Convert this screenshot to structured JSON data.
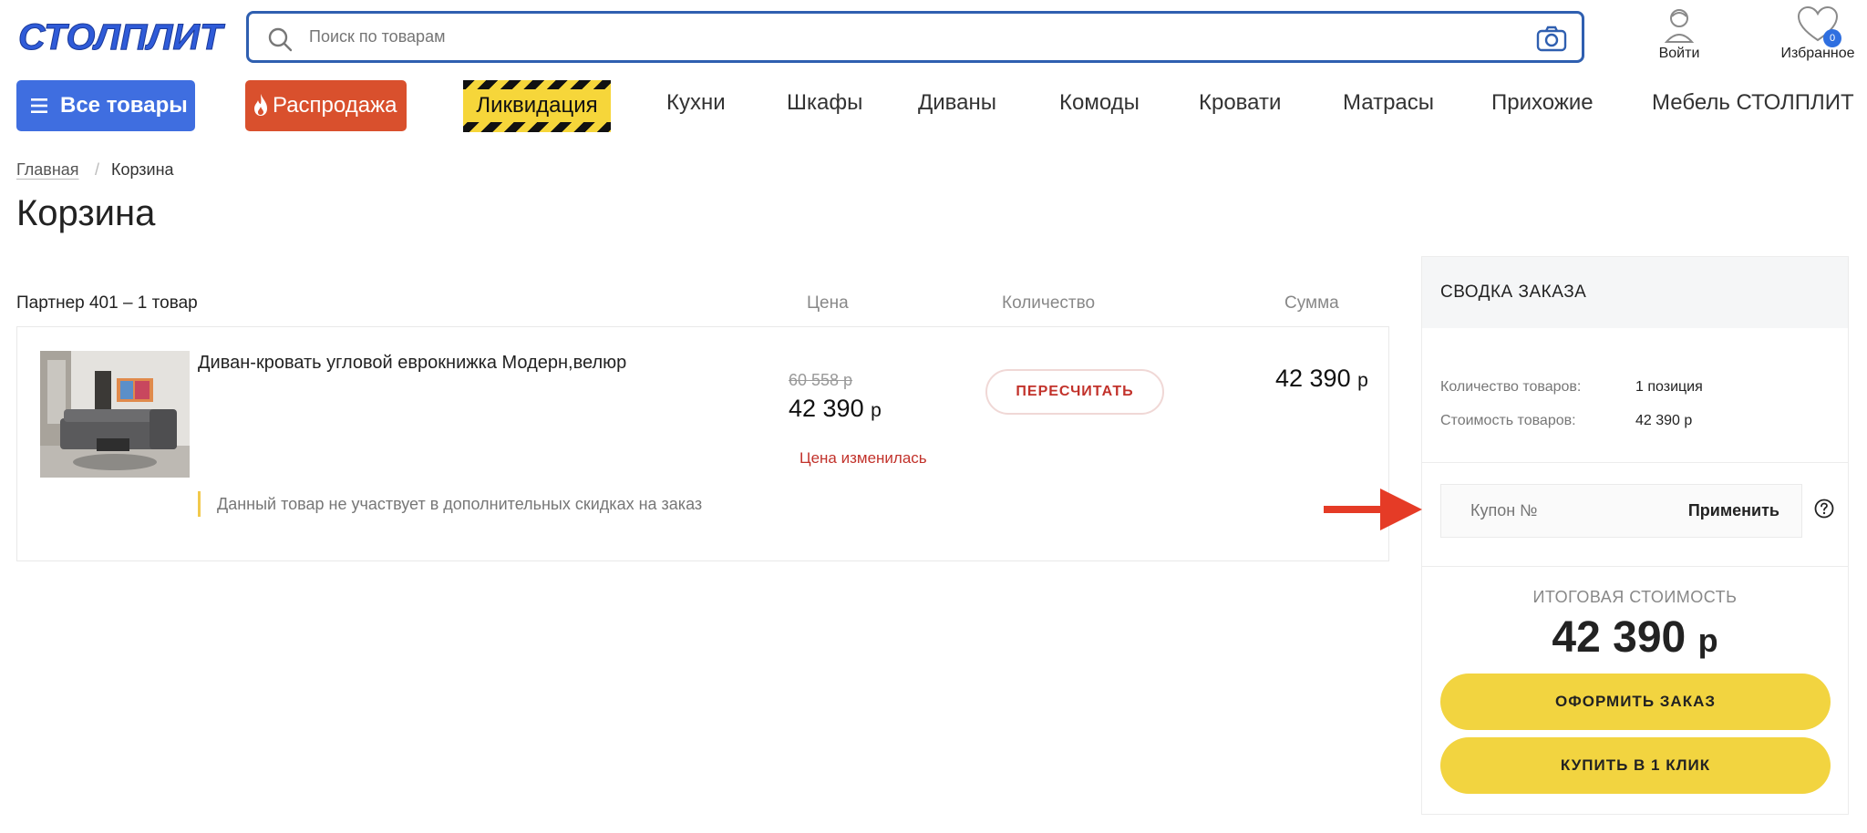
{
  "header": {
    "logo_text": "СТОЛПЛИТ",
    "search_placeholder": "Поиск по товарам",
    "login_label": "Войти",
    "favorites_label": "Избранное",
    "favorites_count": "0"
  },
  "nav": {
    "all_products": "Все товары",
    "sale": "Распродажа",
    "liquidation": "Ликвидация",
    "links": [
      "Кухни",
      "Шкафы",
      "Диваны",
      "Комоды",
      "Кровати",
      "Матрасы",
      "Прихожие",
      "Мебель СТОЛПЛИТ"
    ]
  },
  "breadcrumb": {
    "home": "Главная",
    "separator": "/",
    "current": "Корзина"
  },
  "page_title": "Корзина",
  "cart": {
    "group_title": "Партнер 401 – 1 товар",
    "columns": {
      "price": "Цена",
      "quantity": "Количество",
      "sum": "Сумма"
    },
    "item": {
      "name": "Диван-кровать угловой еврокнижка Модерн,велюр",
      "old_price": "60 558 р",
      "new_price": "42 390",
      "currency": "р",
      "recalc_button": "ПЕРЕСЧИТАТЬ",
      "price_changed": "Цена изменилась",
      "sum": "42 390",
      "discount_note": "Данный товар не участвует в дополнительных скидках на заказ"
    }
  },
  "summary": {
    "title": "СВОДКА ЗАКАЗА",
    "items_count_label": "Количество товаров:",
    "items_count_value": "1 позиция",
    "items_cost_label": "Стоимость товаров:",
    "items_cost_value": "42 390 р",
    "coupon_placeholder": "Купон №",
    "apply_button": "Применить",
    "total_label": "ИТОГОВАЯ СТОИМОСТЬ",
    "total_value": "42 390",
    "currency": "р",
    "checkout_button": "ОФОРМИТЬ ЗАКАЗ",
    "one_click_button": "КУПИТЬ В 1 КЛИК"
  },
  "colors": {
    "brand_blue": "#3f6ee0",
    "sale_red": "#d9502d",
    "accent_yellow": "#f2d440",
    "warning_red": "#c2322b",
    "annotation_arrow": "#e53b26"
  }
}
